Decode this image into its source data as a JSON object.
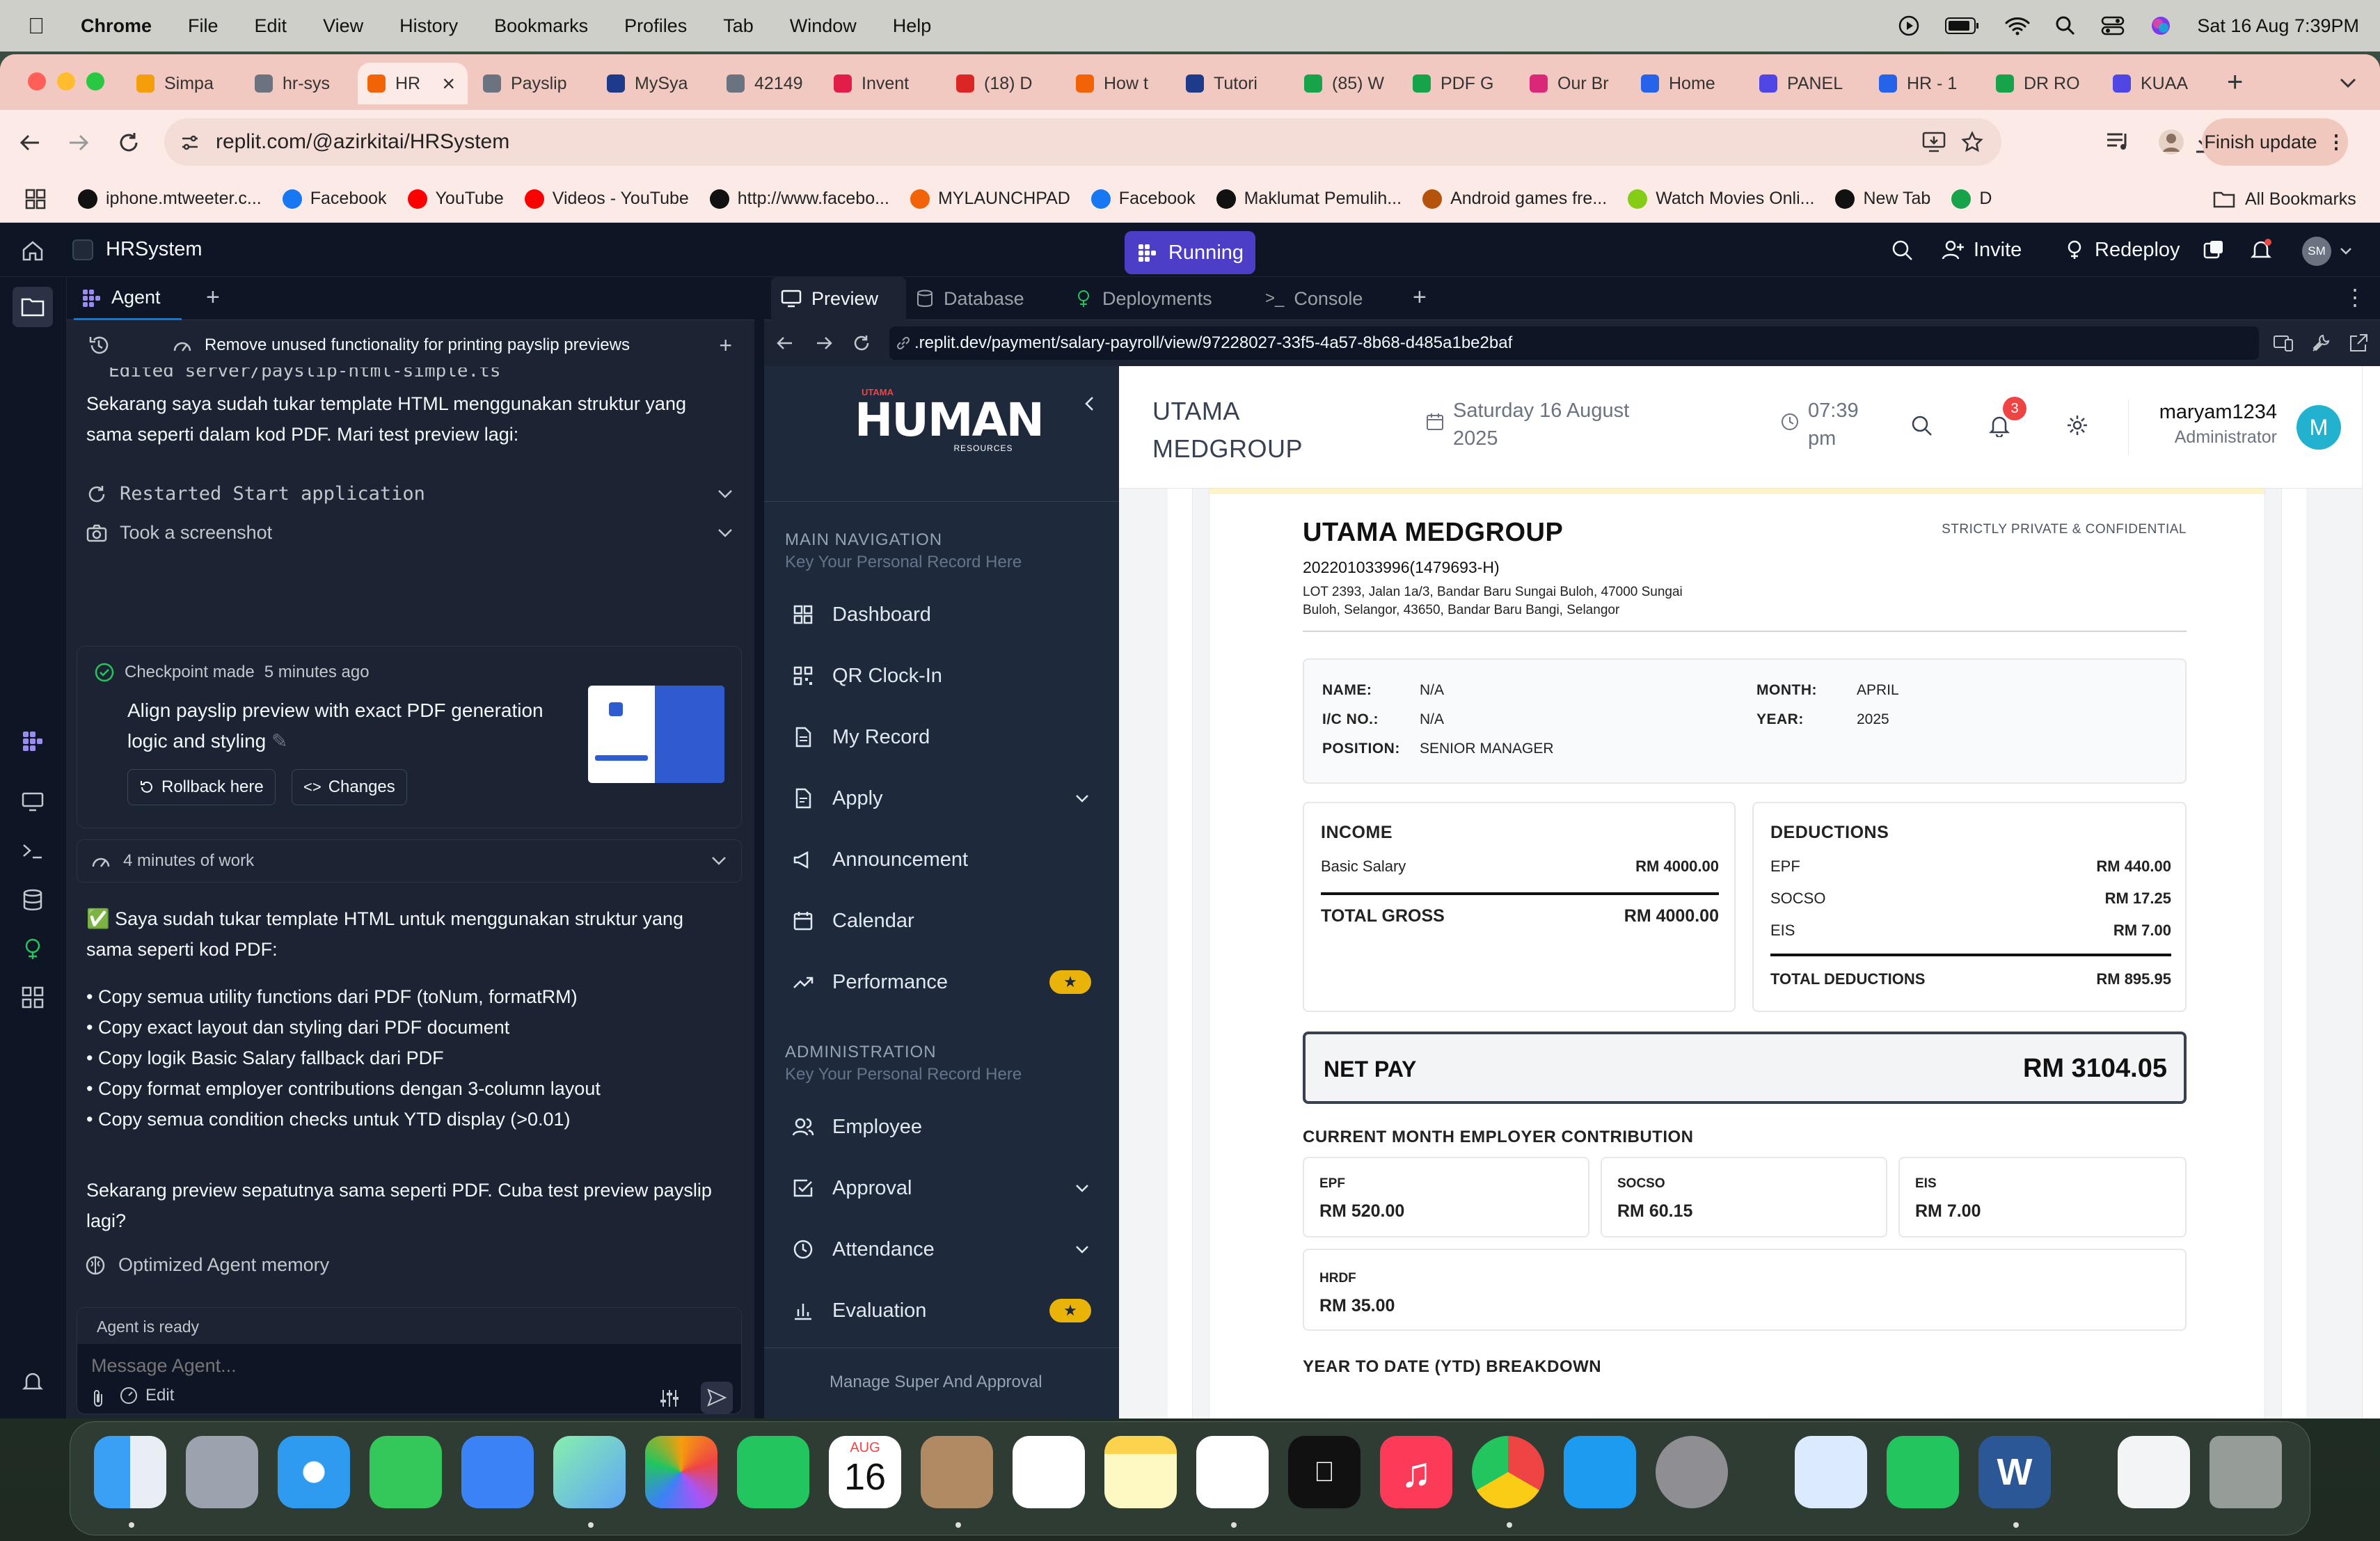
{
  "menubar": {
    "app": "Chrome",
    "items": [
      "File",
      "Edit",
      "View",
      "History",
      "Bookmarks",
      "Profiles",
      "Tab",
      "Window",
      "Help"
    ],
    "datetime": "Sat 16 Aug  7:39PM"
  },
  "browser": {
    "tabs": [
      {
        "label": "Simpa",
        "color": "#f59e0b"
      },
      {
        "label": "hr-sys",
        "color": "#6b7280"
      },
      {
        "label": "HR",
        "color": "#f26207",
        "active": true
      },
      {
        "label": "Payslip",
        "color": "#6b7280"
      },
      {
        "label": "MySya",
        "color": "#1e3a8a"
      },
      {
        "label": "42149",
        "color": "#6b7280"
      },
      {
        "label": "Invent",
        "color": "#e11d48"
      },
      {
        "label": "(18) D",
        "color": "#dc2626"
      },
      {
        "label": "How t",
        "color": "#f26207"
      },
      {
        "label": "Tutori",
        "color": "#1e3a8a"
      },
      {
        "label": "(85) W",
        "color": "#16a34a"
      },
      {
        "label": "PDF G",
        "color": "#16a34a"
      },
      {
        "label": "Our Br",
        "color": "#db2777"
      },
      {
        "label": "Home",
        "color": "#2563eb"
      },
      {
        "label": "PANEL",
        "color": "#4f46e5"
      },
      {
        "label": "HR - 1",
        "color": "#2563eb"
      },
      {
        "label": "DR RO",
        "color": "#16a34a"
      },
      {
        "label": "KUAA",
        "color": "#4f46e5"
      }
    ],
    "url": "replit.com/@azirkitai/HRSystem",
    "finish_update": "Finish update",
    "bookmarks": [
      {
        "label": "iphone.mtweeter.c...",
        "color": "#111"
      },
      {
        "label": "Facebook",
        "color": "#1877f2"
      },
      {
        "label": "YouTube",
        "color": "#ff0000"
      },
      {
        "label": "Videos - YouTube",
        "color": "#ff0000"
      },
      {
        "label": "http://www.facebo...",
        "color": "#111"
      },
      {
        "label": "MYLAUNCHPAD",
        "color": "#f26207"
      },
      {
        "label": "Facebook",
        "color": "#1877f2"
      },
      {
        "label": "Maklumat Pemulih...",
        "color": "#111"
      },
      {
        "label": "Android games fre...",
        "color": "#b45309"
      },
      {
        "label": "Watch Movies Onli...",
        "color": "#84cc16"
      },
      {
        "label": "New Tab",
        "color": "#111"
      },
      {
        "label": "D",
        "color": "#16a34a"
      }
    ],
    "all_bookmarks": "All Bookmarks"
  },
  "replit": {
    "project": "HRSystem",
    "running": "Running",
    "invite": "Invite",
    "redeploy": "Redeploy",
    "avatar": "SM",
    "agent_tab": "Agent",
    "history_title": "Remove unused functionality for printing payslip previews",
    "edited_file": "Edited server/payslip-html-simple.ts",
    "msg1": "Sekarang saya sudah tukar template HTML menggunakan struktur yang sama seperti dalam kod PDF. Mari test preview lagi:",
    "restarted": "Restarted Start application",
    "screenshot": "Took a screenshot",
    "checkpoint_made": "Checkpoint made",
    "checkpoint_time": "5 minutes ago",
    "checkpoint_title": "Align payslip preview with exact PDF generation logic and styling",
    "rollback": "Rollback here",
    "changes": "Changes",
    "work_time": "4 minutes of work",
    "msg2": "✅ Saya sudah tukar template HTML untuk menggunakan struktur yang sama seperti kod PDF:",
    "bullets": [
      "• Copy semua utility functions dari PDF (toNum, formatRM)",
      "• Copy exact layout dan styling dari PDF document",
      "• Copy logik Basic Salary fallback dari PDF",
      "• Copy format employer contributions dengan 3-column layout",
      "• Copy semua condition checks untuk YTD display (>0.01)"
    ],
    "msg3": "Sekarang preview sepatutnya sama seperti PDF. Cuba test preview payslip lagi?",
    "memory": "Optimized Agent memory",
    "agent_ready": "Agent is ready",
    "message_placeholder": "Message Agent...",
    "edit": "Edit",
    "pane_tabs": [
      "Preview",
      "Database",
      "Deployments",
      "Console"
    ],
    "preview_url": ".replit.dev/payment/salary-payroll/view/97228027-33f5-4a57-8b68-d485a1be2baf"
  },
  "hrapp": {
    "logo_small": "UTAMA",
    "logo_big": "HUMAN",
    "logo_sub": "RESOURCES",
    "main_nav": "MAIN NAVIGATION",
    "main_nav_sub": "Key Your Personal Record Here",
    "nav": [
      "Dashboard",
      "QR Clock-In",
      "My Record",
      "Apply",
      "Announcement",
      "Calendar",
      "Performance"
    ],
    "admin": "ADMINISTRATION",
    "admin_sub": "Key Your Personal Record Here",
    "admin_nav": [
      "Employee",
      "Approval",
      "Attendance",
      "Evaluation"
    ],
    "footer": "Manage Super And Approval",
    "company": "UTAMA MEDGROUP",
    "date": "Saturday 16 August 2025",
    "time": "07:39 pm",
    "notif_count": "3",
    "username": "maryam1234",
    "role": "Administrator",
    "avatar": "M"
  },
  "payslip": {
    "company": "UTAMA MEDGROUP",
    "reg_no": "202201033996(1479693-H)",
    "address1": "LOT 2393, Jalan 1a/3, Bandar Baru Sungai Buloh, 47000 Sungai",
    "address2": "Buloh, Selangor, 43650, Bandar Baru Bangi, Selangor",
    "confidential": "STRICTLY PRIVATE & CONFIDENTIAL",
    "name_label": "NAME:",
    "name": "N/A",
    "ic_label": "I/C NO.:",
    "ic": "N/A",
    "position_label": "POSITION:",
    "position": "SENIOR MANAGER",
    "month_label": "MONTH:",
    "month": "APRIL",
    "year_label": "YEAR:",
    "year": "2025",
    "income_title": "INCOME",
    "basic_salary_label": "Basic Salary",
    "basic_salary": "RM 4000.00",
    "total_gross_label": "TOTAL GROSS",
    "total_gross": "RM 4000.00",
    "deductions_title": "DEDUCTIONS",
    "deductions": [
      {
        "label": "EPF",
        "value": "RM 440.00"
      },
      {
        "label": "SOCSO",
        "value": "RM 17.25"
      },
      {
        "label": "EIS",
        "value": "RM 7.00"
      }
    ],
    "total_deductions_label": "TOTAL DEDUCTIONS",
    "total_deductions": "RM 895.95",
    "net_pay_label": "NET PAY",
    "net_pay": "RM 3104.05",
    "employer_title": "CURRENT MONTH EMPLOYER CONTRIBUTION",
    "employer": [
      {
        "label": "EPF",
        "value": "RM 520.00"
      },
      {
        "label": "SOCSO",
        "value": "RM 60.15"
      },
      {
        "label": "EIS",
        "value": "RM 7.00"
      }
    ],
    "hrdf_label": "HRDF",
    "hrdf": "RM 35.00",
    "ytd_title": "YEAR TO DATE (YTD) BREAKDOWN"
  },
  "dock": {
    "calendar_month": "AUG",
    "calendar_day": "16"
  }
}
